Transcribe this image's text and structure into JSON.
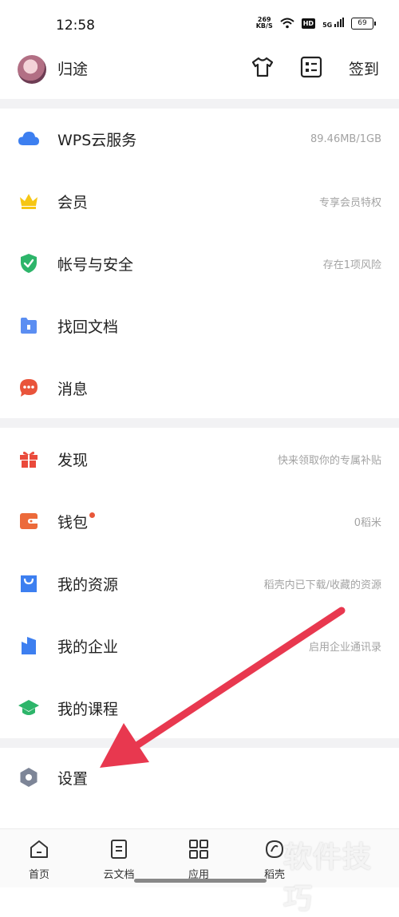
{
  "status_bar": {
    "time": "12:58",
    "net_speed_value": "269",
    "net_speed_unit": "KB/S",
    "hd": "HD",
    "signal": "5G",
    "battery": "69"
  },
  "header": {
    "username": "归途",
    "checkin_label": "签到"
  },
  "sections": [
    {
      "items": [
        {
          "label": "WPS云服务",
          "sub": "89.46MB/1GB",
          "icon": "cloud-icon",
          "color": "#3d7ff0"
        },
        {
          "label": "会员",
          "sub": "专享会员特权",
          "icon": "crown-icon",
          "color": "#f6c614"
        },
        {
          "label": "帐号与安全",
          "sub": "存在1项风险",
          "icon": "shield-icon",
          "color": "#2db56a"
        },
        {
          "label": "找回文档",
          "sub": "",
          "icon": "folder-icon",
          "color": "#5b8ef2"
        },
        {
          "label": "消息",
          "sub": "",
          "icon": "message-icon",
          "color": "#e9543b"
        }
      ]
    },
    {
      "items": [
        {
          "label": "发现",
          "sub": "快来领取你的专属补贴",
          "icon": "gift-icon",
          "color": "#ea4a3b"
        },
        {
          "label": "钱包",
          "sub": "0稻米",
          "icon": "wallet-icon",
          "color": "#ec6a3a",
          "badge": true
        },
        {
          "label": "我的资源",
          "sub": "稻壳内已下载/收藏的资源",
          "icon": "bag-icon",
          "color": "#3d7ff0"
        },
        {
          "label": "我的企业",
          "sub": "启用企业通讯录",
          "icon": "building-icon",
          "color": "#3d7ff0"
        },
        {
          "label": "我的课程",
          "sub": "",
          "icon": "graduation-cap-icon",
          "color": "#2db56a"
        }
      ]
    },
    {
      "items": [
        {
          "label": "设置",
          "sub": "",
          "icon": "settings-icon",
          "color": "#7d8597"
        }
      ]
    }
  ],
  "bottom_nav": [
    {
      "label": "首页",
      "icon": "home-icon"
    },
    {
      "label": "云文档",
      "icon": "document-icon"
    },
    {
      "label": "应用",
      "icon": "apps-grid-icon"
    },
    {
      "label": "稻壳",
      "icon": "daoke-icon"
    }
  ],
  "annotation": {
    "arrow_color": "#e8384f"
  },
  "watermark": "软件技巧"
}
